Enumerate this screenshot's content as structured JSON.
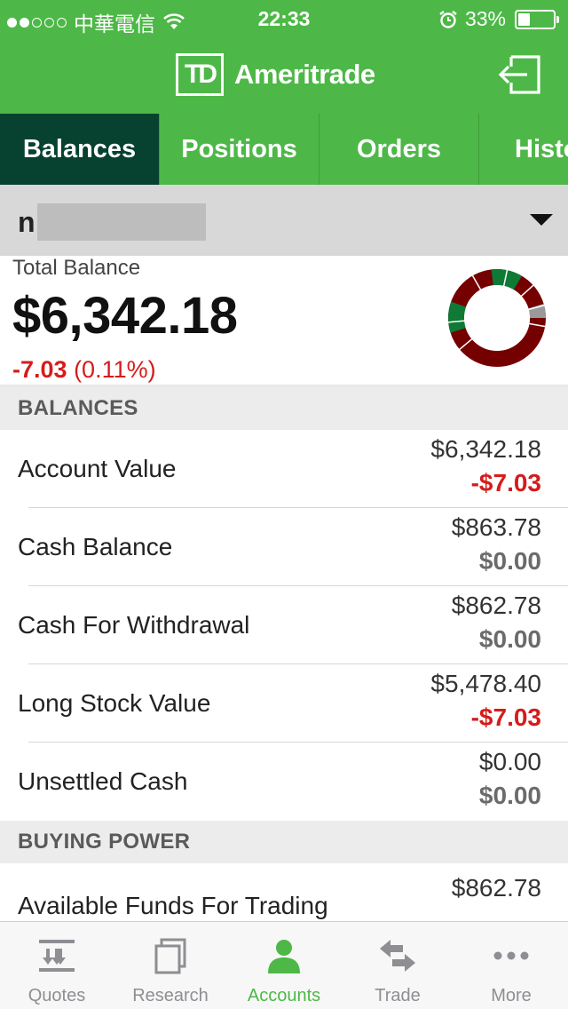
{
  "status_bar": {
    "carrier": "中華電信",
    "time": "22:33",
    "battery_percent": "33%",
    "battery_level": 0.33,
    "signal_bars_filled": 2,
    "signal_bars_total": 5
  },
  "header": {
    "logo_mark": "TD",
    "brand": "Ameritrade",
    "logout_icon": "logout-icon"
  },
  "tabs": [
    {
      "label": "Balances",
      "active": true
    },
    {
      "label": "Positions",
      "active": false
    },
    {
      "label": "Orders",
      "active": false
    },
    {
      "label": "History",
      "active": false
    }
  ],
  "account": {
    "name_visible": "n"
  },
  "total_balance": {
    "label": "Total Balance",
    "value": "$6,342.18",
    "change_amount": "-7.03",
    "change_percent": "(0.11%)"
  },
  "allocation_donut": {
    "colors": {
      "dark_red": "#750000",
      "green": "#0e7a36",
      "gray": "#9a9a9a"
    }
  },
  "balances": {
    "section_title": "BALANCES",
    "rows": [
      {
        "label": "Account Value",
        "value": "$6,342.18",
        "change": "-$7.03",
        "change_tone": "neg"
      },
      {
        "label": "Cash Balance",
        "value": "$863.78",
        "change": "$0.00",
        "change_tone": "zero"
      },
      {
        "label": "Cash For Withdrawal",
        "value": "$862.78",
        "change": "$0.00",
        "change_tone": "zero"
      },
      {
        "label": "Long Stock Value",
        "value": "$5,478.40",
        "change": "-$7.03",
        "change_tone": "neg"
      },
      {
        "label": "Unsettled Cash",
        "value": "$0.00",
        "change": "$0.00",
        "change_tone": "zero"
      }
    ]
  },
  "buying_power": {
    "section_title": "BUYING POWER",
    "rows": [
      {
        "label": "Available Funds For Trading",
        "value": "$862.78"
      }
    ]
  },
  "bottom_tabs": [
    {
      "label": "Quotes",
      "icon": "quotes-icon",
      "active": false
    },
    {
      "label": "Research",
      "icon": "research-icon",
      "active": false
    },
    {
      "label": "Accounts",
      "icon": "accounts-icon",
      "active": true
    },
    {
      "label": "Trade",
      "icon": "trade-icon",
      "active": false
    },
    {
      "label": "More",
      "icon": "more-icon",
      "active": false
    }
  ],
  "colors": {
    "brand_green": "#4db847",
    "active_tab": "#07412f",
    "negative": "#d51c1c"
  }
}
